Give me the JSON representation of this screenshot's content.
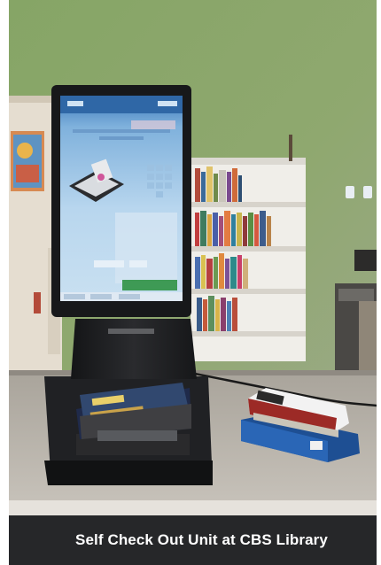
{
  "photo": {
    "scene": "library-self-checkout-kiosk",
    "colors": {
      "wall": "#8ba46b",
      "kiosk_body": "#1d1e20",
      "screen_top": "#3a74b4",
      "screen_bottom": "#bcd7ec",
      "desk": "#b9b3aa",
      "shelf": "#eceae4"
    }
  },
  "caption": {
    "text": "Self Check Out Unit at CBS Library",
    "background": "#262729",
    "color": "#ffffff"
  }
}
